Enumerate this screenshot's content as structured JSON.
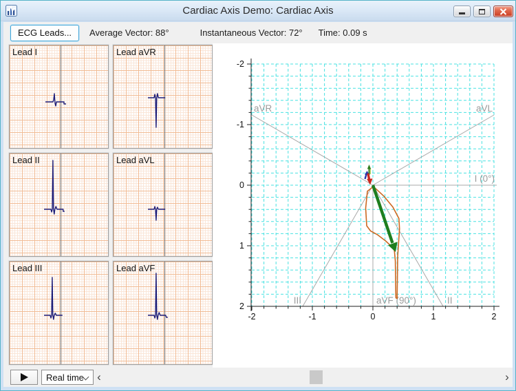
{
  "window": {
    "title": "Cardiac Axis Demo: Cardiac Axis"
  },
  "toolbar": {
    "ecg_leads_button": "ECG Leads...",
    "average_vector_label": "Average Vector: 88°",
    "instantaneous_vector_label": "Instantaneous Vector: 72°",
    "time_label": "Time: 0.09 s"
  },
  "leads": [
    {
      "label": "Lead I"
    },
    {
      "label": "Lead aVR"
    },
    {
      "label": "Lead II"
    },
    {
      "label": "Lead aVL"
    },
    {
      "label": "Lead III"
    },
    {
      "label": "Lead aVF"
    }
  ],
  "axis_plot": {
    "x_ticks": [
      "-2",
      "-1",
      "0",
      "1",
      "2"
    ],
    "y_ticks": [
      "-2",
      "-1",
      "0",
      "1",
      "2"
    ],
    "axis_labels": {
      "aVR": "aVR",
      "aVL": "aVL",
      "I": "I (0°)",
      "III": "III",
      "aVF": "aVF (90°)",
      "II": "II"
    },
    "colors": {
      "grid": "#47e2e2",
      "ray": "#a9a9a9",
      "ray_label": "#9c9c9c",
      "loop": "#cc6820",
      "instantaneous_vector": "#1e7e1e",
      "average_vector": "#c9281e",
      "blue_marker": "#2b35a8",
      "ecg_trace": "#1c1c78",
      "ecg_paper_major": "#f1bb94",
      "ecg_paper_minor": "#fae6d8"
    }
  },
  "chart_data": {
    "type": "line",
    "title": "Cardiac axis hexaxial vector plot",
    "x_range": [
      -2,
      2
    ],
    "y_range": [
      -2,
      2
    ],
    "y_axis_inverted": true,
    "grid": "dashed cyan, 0.2 unit spacing",
    "x_tick_values": [
      -2,
      -1,
      0,
      1,
      2
    ],
    "y_tick_values": [
      -2,
      -1,
      0,
      1,
      2
    ],
    "axis_rays": [
      {
        "label": "I (0°)",
        "angle_deg": 0
      },
      {
        "label": "II",
        "angle_deg": 60
      },
      {
        "label": "III",
        "angle_deg": 120
      },
      {
        "label": "aVF (90°)",
        "angle_deg": 90
      },
      {
        "label": "aVR",
        "angle_deg": -150
      },
      {
        "label": "aVL",
        "angle_deg": -30
      }
    ],
    "instantaneous_vector": {
      "angle_deg": 72,
      "tip_xy": [
        0.37,
        1.09
      ],
      "color": "#1e7e1e"
    },
    "average_vector": {
      "angle_deg": 88,
      "color": "#c9281e"
    },
    "time_s": 0.09,
    "vector_loop_xy": [
      [
        0.0,
        0.03
      ],
      [
        -0.09,
        0.1
      ],
      [
        -0.12,
        0.38
      ],
      [
        -0.1,
        0.67
      ],
      [
        -0.04,
        0.76
      ],
      [
        0.08,
        0.82
      ],
      [
        0.21,
        0.92
      ],
      [
        0.32,
        1.02
      ],
      [
        0.36,
        1.08
      ],
      [
        0.37,
        1.25
      ],
      [
        0.38,
        1.86
      ],
      [
        0.4,
        1.87
      ],
      [
        0.41,
        1.18
      ],
      [
        0.44,
        0.72
      ],
      [
        0.43,
        0.55
      ],
      [
        0.33,
        0.36
      ],
      [
        0.18,
        0.18
      ],
      [
        0.05,
        0.06
      ]
    ],
    "loop_color": "#cc6820"
  },
  "bottom_bar": {
    "mode_select_value": "Real time",
    "scroll_left": "‹",
    "scroll_right": "›"
  }
}
